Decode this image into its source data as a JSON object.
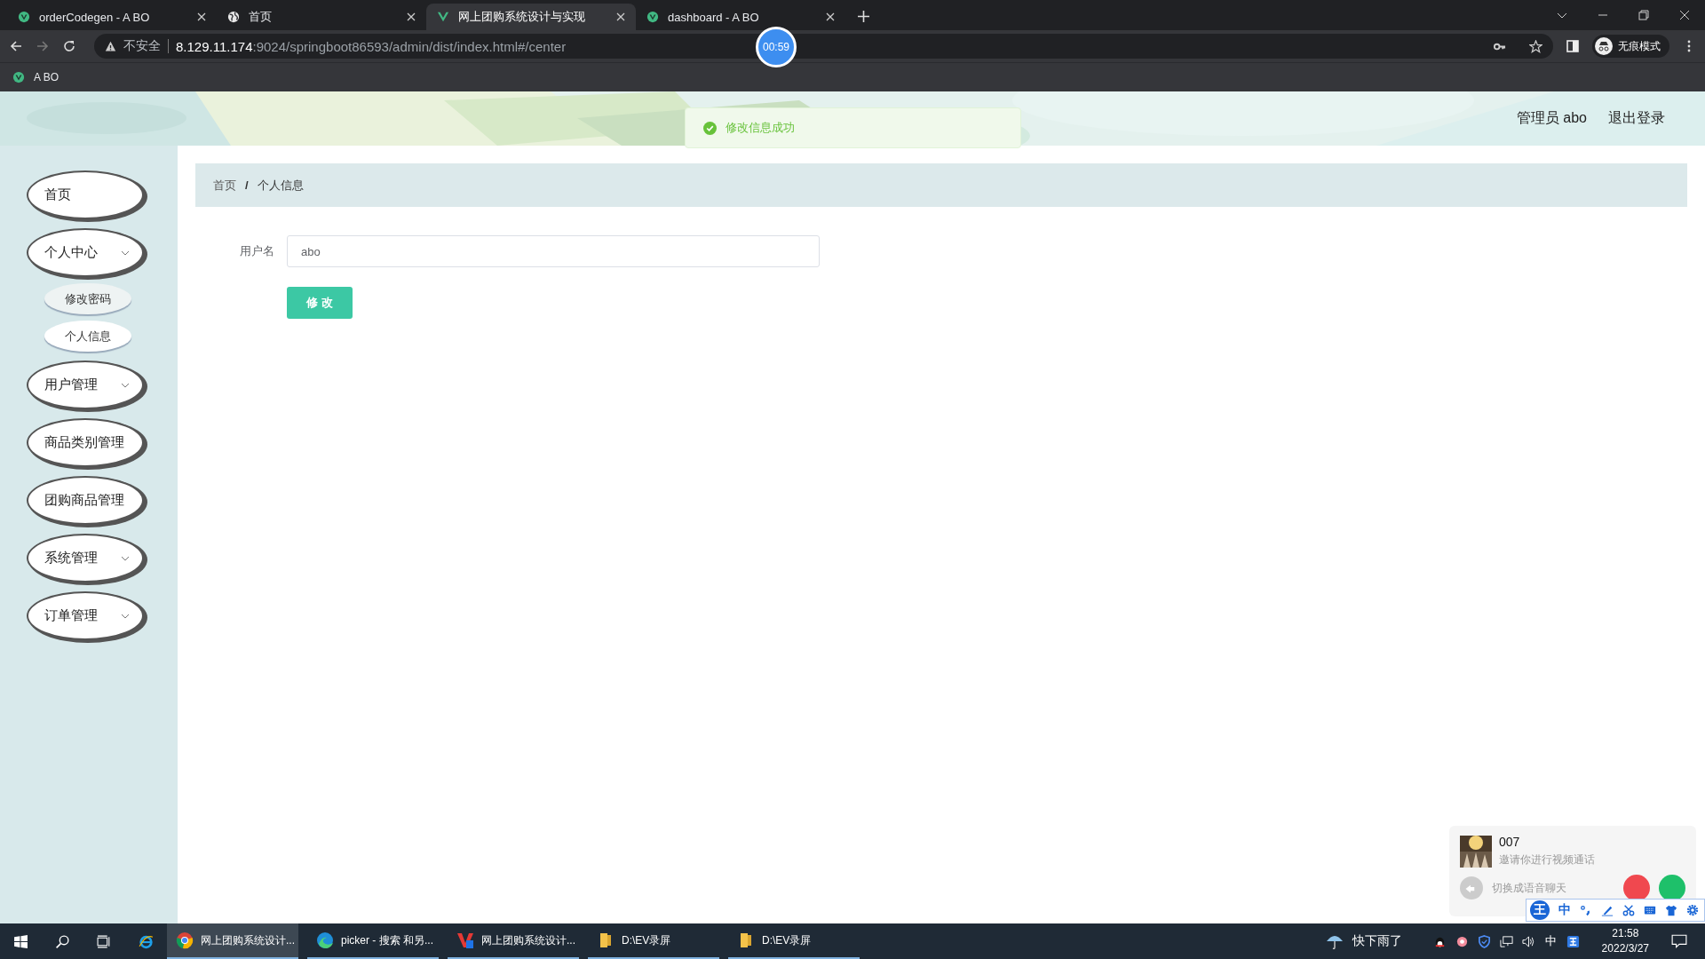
{
  "browser": {
    "tabs": [
      {
        "title": "orderCodegen - A BO",
        "kind": "vue",
        "selected": false
      },
      {
        "title": "首页",
        "kind": "globe",
        "selected": false
      },
      {
        "title": "网上团购系统设计与实现",
        "kind": "vue",
        "selected": true
      },
      {
        "title": "dashboard - A BO",
        "kind": "vue",
        "selected": false
      }
    ],
    "address": {
      "security_label": "不安全",
      "host": "8.129.11.174",
      "path": ":9024/springboot86593/admin/dist/index.html#/center"
    },
    "profile_label": "无痕模式",
    "bookmarks": [
      "A BO"
    ],
    "recorder_timer": "00:59"
  },
  "app": {
    "header": {
      "user_label": "管理员 abo",
      "logout": "退出登录"
    },
    "toast": {
      "message": "修改信息成功"
    },
    "sidebar": {
      "items": [
        {
          "label": "首页",
          "has_submenu": false,
          "expanded": false
        },
        {
          "label": "个人中心",
          "has_submenu": true,
          "expanded": true,
          "children": [
            {
              "label": "修改密码",
              "selected": false
            },
            {
              "label": "个人信息",
              "selected": true
            }
          ]
        },
        {
          "label": "用户管理",
          "has_submenu": true,
          "expanded": false
        },
        {
          "label": "商品类别管理",
          "has_submenu": false,
          "expanded": false
        },
        {
          "label": "团购商品管理",
          "has_submenu": false,
          "expanded": false
        },
        {
          "label": "系统管理",
          "has_submenu": true,
          "expanded": false
        },
        {
          "label": "订单管理",
          "has_submenu": true,
          "expanded": false
        }
      ]
    },
    "breadcrumb": [
      "首页",
      "个人信息"
    ],
    "breadcrumb_separator": "/",
    "form": {
      "fields": [
        {
          "label": "用户名",
          "value": "abo"
        }
      ],
      "submit_button": "修 改"
    }
  },
  "call_popup": {
    "caller": "007",
    "message": "邀请你进行视频通话",
    "switch_label": "切换成语音聊天"
  },
  "ime_toolbar": {
    "logo": "王",
    "mode": "中"
  },
  "taskbar": {
    "apps": [
      {
        "label": "网上团购系统设计...",
        "kind": "chrome",
        "selected": true
      },
      {
        "label": "picker - 搜索 和另...",
        "kind": "edge",
        "selected": false
      },
      {
        "label": "网上团购系统设计...",
        "kind": "editor",
        "selected": false
      },
      {
        "label": "D:\\EV录屏",
        "kind": "folder",
        "selected": false
      },
      {
        "label": "D:\\EV录屏",
        "kind": "folder",
        "selected": false
      }
    ],
    "weather": "快下雨了",
    "input_mode": "中",
    "time": "21:58",
    "date": "2022/3/27"
  }
}
